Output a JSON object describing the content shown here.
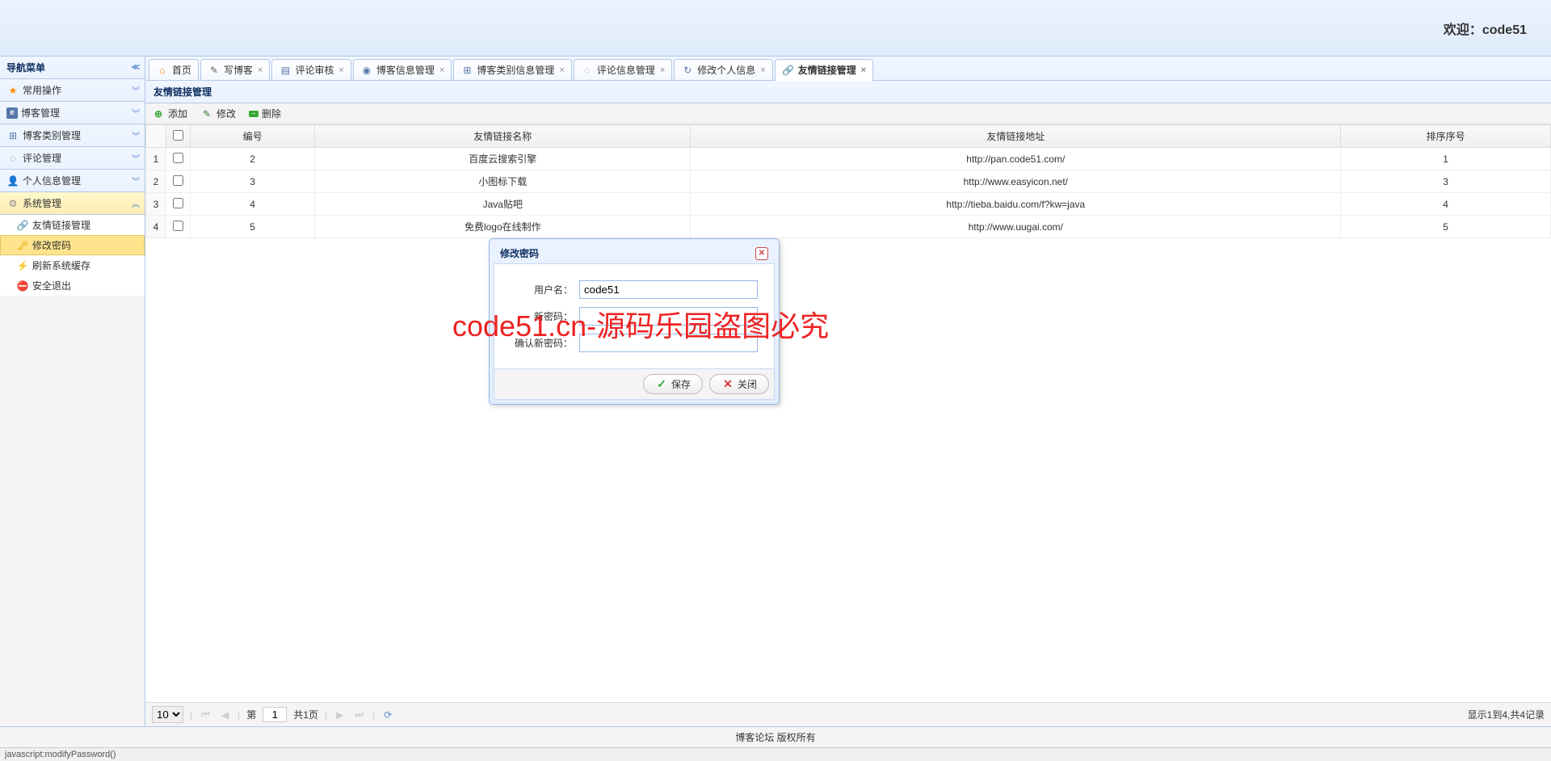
{
  "header": {
    "welcome_prefix": "欢迎：",
    "user": "code51"
  },
  "sidebar": {
    "title": "导航菜单",
    "items": [
      {
        "label": "常用操作",
        "icon": "star"
      },
      {
        "label": "博客管理",
        "icon": "e"
      },
      {
        "label": "博客类别管理",
        "icon": "tree"
      },
      {
        "label": "评论管理",
        "icon": "bubble"
      },
      {
        "label": "个人信息管理",
        "icon": "user"
      },
      {
        "label": "系统管理",
        "icon": "gear",
        "active": true
      }
    ],
    "tree": [
      {
        "label": "友情链接管理",
        "icon": "link"
      },
      {
        "label": "修改密码",
        "icon": "key",
        "selected": true
      },
      {
        "label": "刷新系统缓存",
        "icon": "bolt"
      },
      {
        "label": "安全退出",
        "icon": "stop"
      }
    ]
  },
  "tabs": [
    {
      "label": "首页",
      "icon": "home",
      "closable": false
    },
    {
      "label": "写博客",
      "icon": "edit",
      "closable": true
    },
    {
      "label": "评论审核",
      "icon": "comment",
      "closable": true
    },
    {
      "label": "博客信息管理",
      "icon": "db",
      "closable": true
    },
    {
      "label": "博客类别信息管理",
      "icon": "tree",
      "closable": true
    },
    {
      "label": "评论信息管理",
      "icon": "bubble",
      "closable": true
    },
    {
      "label": "修改个人信息",
      "icon": "refresh",
      "closable": true
    },
    {
      "label": "友情链接管理",
      "icon": "link",
      "closable": true,
      "active": true
    }
  ],
  "panel": {
    "title": "友情链接管理"
  },
  "toolbar": {
    "add": "添加",
    "edit": "修改",
    "del": "删除"
  },
  "grid": {
    "columns": [
      "编号",
      "友情链接名称",
      "友情链接地址",
      "排序序号"
    ],
    "rows": [
      {
        "n": "1",
        "id": "2",
        "name": "百度云搜索引擎",
        "url": "http://pan.code51.com/",
        "sort": "1"
      },
      {
        "n": "2",
        "id": "3",
        "name": "小图标下载",
        "url": "http://www.easyicon.net/",
        "sort": "3"
      },
      {
        "n": "3",
        "id": "4",
        "name": "Java贴吧",
        "url": "http://tieba.baidu.com/f?kw=java",
        "sort": "4"
      },
      {
        "n": "4",
        "id": "5",
        "name": "免费logo在线制作",
        "url": "http://www.uugai.com/",
        "sort": "5"
      }
    ]
  },
  "pager": {
    "page_size": "10",
    "page_label_prefix": "第",
    "page": "1",
    "total_pages_text": "共1页",
    "info": "显示1到4,共4记录"
  },
  "dialog": {
    "title": "修改密码",
    "username_label": "用户名：",
    "username_value": "code51",
    "newpwd_label": "新密码：",
    "confirm_label": "确认新密码：",
    "save": "保存",
    "close": "关闭"
  },
  "footer": {
    "copyright": "博客论坛 版权所有"
  },
  "statusbar": {
    "text": "javascript:modifyPassword()"
  },
  "watermark": "code51.cn-源码乐园盗图必究"
}
